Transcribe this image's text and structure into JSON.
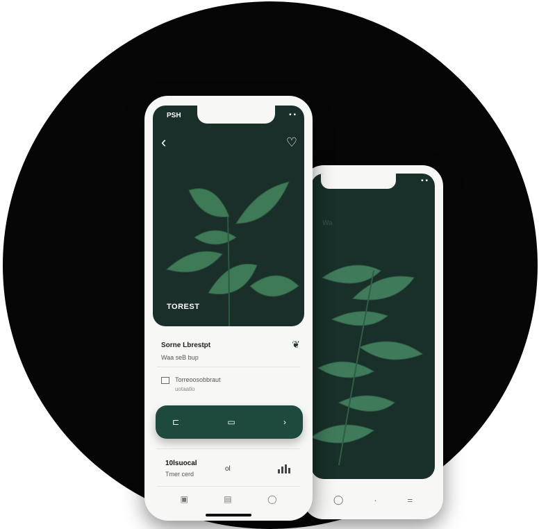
{
  "front_phone": {
    "status_time": "PSH",
    "status_right": "▪ ▪",
    "back_icon": "chevron-left-icon",
    "favorite_icon": "heart-icon",
    "image_caption": "TOREST",
    "card": {
      "title": "Sorne Lbrestpt",
      "subtitle": "Waa seB bup",
      "icon": "leaf-icon"
    },
    "info": {
      "line1": "Torreoosobbraut",
      "line2": "uotaatlo"
    },
    "action_bar": {
      "left_icon": "collapse-icon",
      "center_icon": "card-icon",
      "right_icon": "expand-icon"
    },
    "stats": {
      "title": "10lsuocal",
      "subtitle": "Tmer cerd",
      "middle": "ol",
      "chart_icon": "bar-chart-icon"
    },
    "bottom_nav": [
      "calendar-icon",
      "grid-icon",
      "profile-icon"
    ]
  },
  "back_phone": {
    "status_right": "▪ ▪",
    "small_label": "Wa",
    "bottom_nav": [
      "home-icon",
      "dot-icon",
      "menu-icon"
    ]
  }
}
